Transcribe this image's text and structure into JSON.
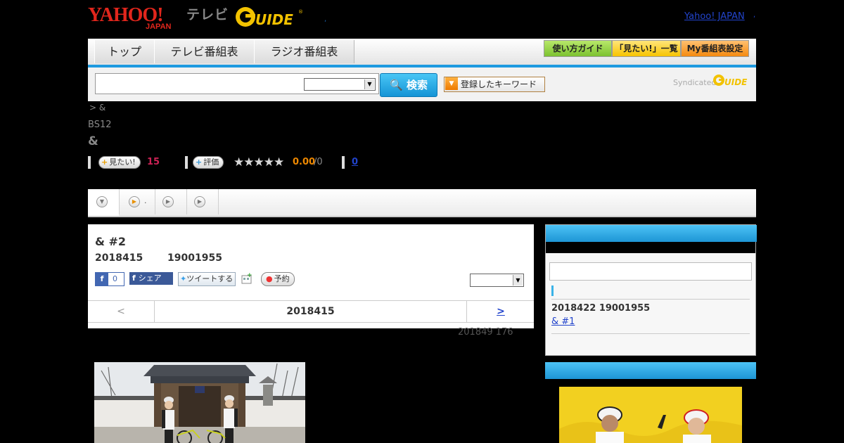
{
  "header": {
    "logo_text": "YAHOO! JAPAN",
    "tv_label": "テレビ",
    "gguide_logo_text": "G GUIDE",
    "top_link": "Yahoo! JAPAN",
    "top_link_suffix": ",",
    "header_mark": ","
  },
  "nav": {
    "tabs": [
      "トップ",
      "テレビ番組表",
      "ラジオ番組表"
    ],
    "buttons": [
      "使い方ガイド",
      "「見たい!」一覧",
      "My番組表設定"
    ]
  },
  "search": {
    "input_value": "",
    "select_value": "",
    "button_label": "検索",
    "keyword_button_label": "登録したキーワード",
    "syndicated_label": "Syndicated"
  },
  "program": {
    "breadcrumb": "> &",
    "channel": "BS12",
    "title": "&",
    "watch_button": "見たい!",
    "watch_count": "15",
    "rate_button": "評価",
    "stars": "★★★★★",
    "rating": "0.00",
    "rating_of": "/0",
    "review_count": "0"
  },
  "tabs": {
    "second_tab_suffix": "."
  },
  "episode": {
    "title": "& #2",
    "date": "2018415",
    "time": "19001955",
    "fb_like_count": "0",
    "fb_share_label": "シェア",
    "tweet_label": "ツイートする",
    "reserve_label": "予約",
    "select_value": "",
    "prev_label": "<",
    "nav_date": "2018415",
    "next_label": ">",
    "updated": "201849  176"
  },
  "sidebar": {
    "next_date": "2018422  19001955",
    "next_episode_link": "& #1"
  },
  "colors": {
    "accent_blue": "#1e9ae0",
    "watch_count_color": "#cc2255",
    "rating_color": "#ee8800"
  }
}
